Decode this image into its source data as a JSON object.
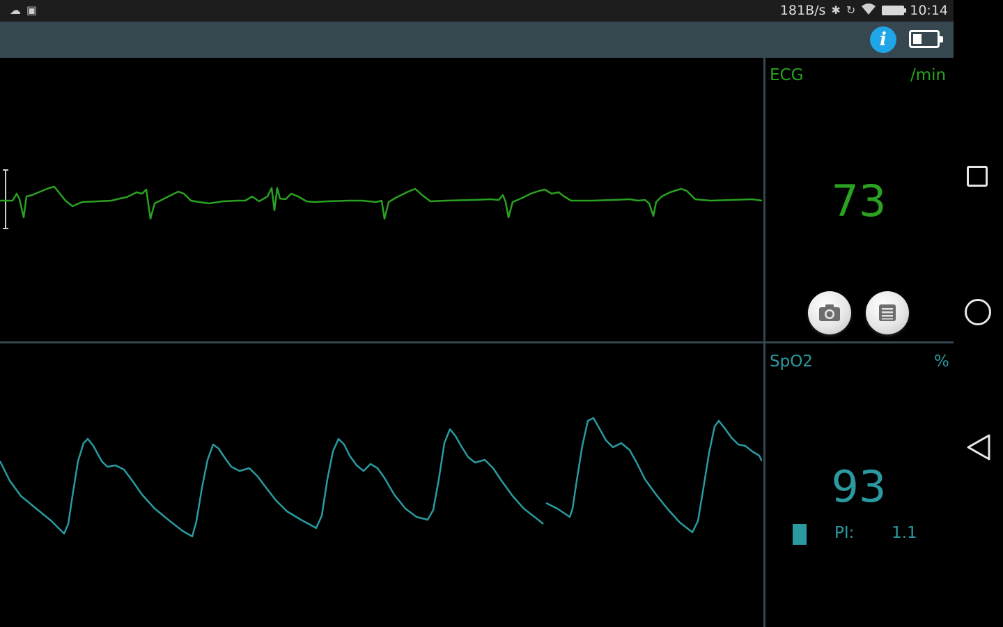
{
  "status_bar": {
    "network_speed": "181B/s",
    "time": "10:14"
  },
  "toolbar": {
    "info_label": "i"
  },
  "ecg": {
    "label": "ECG",
    "unit": "/min",
    "value": "73",
    "color": "#2aa121"
  },
  "spo2": {
    "label": "SpO2",
    "unit": "%",
    "value": "93",
    "pi_label": "PI:",
    "pi_value": "1.1",
    "color": "#2a9aa0"
  },
  "icons": {
    "snapshot": "camera-icon",
    "menu": "list-icon",
    "info": "info-icon",
    "device_battery": "battery-icon"
  }
}
